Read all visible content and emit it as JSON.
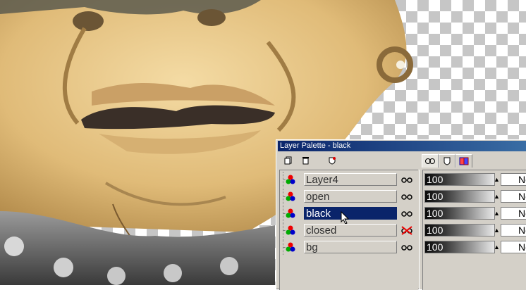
{
  "window": {
    "title": "Layer Palette - black"
  },
  "toolbar": {
    "buttons": [
      {
        "name": "new-layer-icon"
      },
      {
        "name": "delete-layer-icon"
      },
      {
        "name": "mask-icon"
      }
    ],
    "tabs": [
      {
        "name": "layer-properties-tab-icon",
        "active": true
      },
      {
        "name": "mask-tab-icon",
        "active": false
      },
      {
        "name": "layer-group-tab-icon",
        "active": false
      }
    ]
  },
  "layers": [
    {
      "name": "Layer4",
      "visible": true,
      "selected": false,
      "opacity": "100",
      "blend": "Normal"
    },
    {
      "name": "open",
      "visible": true,
      "selected": false,
      "opacity": "100",
      "blend": "Normal"
    },
    {
      "name": "black",
      "visible": true,
      "selected": true,
      "opacity": "100",
      "blend": "Normal"
    },
    {
      "name": "closed",
      "visible": false,
      "selected": false,
      "opacity": "100",
      "blend": "Normal"
    },
    {
      "name": "bg",
      "visible": true,
      "selected": false,
      "opacity": "100",
      "blend": "Normal"
    }
  ],
  "colors": {
    "titlebar": "#0a246a",
    "selection": "#0a246a",
    "skin": "#e4c07e",
    "mouth": "#3a2f28",
    "collar": "#5a5a5a"
  }
}
